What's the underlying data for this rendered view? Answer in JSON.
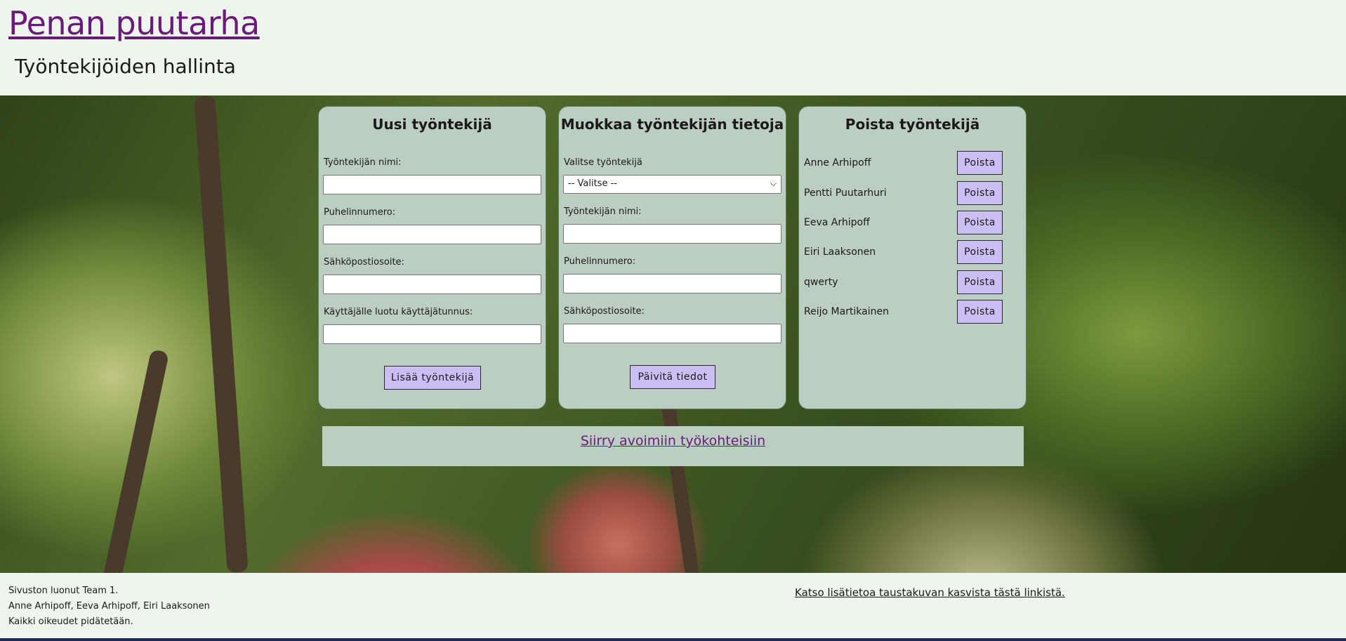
{
  "header": {
    "site_title": "Penan puutarha",
    "page_heading": "Työntekijöiden hallinta"
  },
  "add_panel": {
    "title": "Uusi työntekijä",
    "name_label": "Työntekijän nimi:",
    "phone_label": "Puhelinnumero:",
    "email_label": "Sähköpostiosoite:",
    "username_label": "Käyttäjälle luotu käyttäjätunnus:",
    "submit_label": "Lisää työntekijä"
  },
  "edit_panel": {
    "title": "Muokkaa työntekijän tietoja",
    "select_label": "Valitse työntekijä",
    "select_value": "-- Valitse --",
    "name_label": "Työntekijän nimi:",
    "phone_label": "Puhelinnumero:",
    "email_label": "Sähköpostiosoite:",
    "submit_label": "Päivitä tiedot"
  },
  "delete_panel": {
    "title": "Poista työntekijä",
    "button_label": "Poista",
    "employees": [
      "Anne Arhipoff",
      "Pentti Puutarhuri",
      "Eeva Arhipoff",
      "Eiri Laaksonen",
      "qwerty",
      "Reijo Martikainen"
    ]
  },
  "nav_link": "Siirry avoimiin työkohteisiin",
  "footer": {
    "line1": "Sivuston luonut Team 1.",
    "line2": "Anne Arhipoff, Eeva Arhipoff, Eiri Laaksonen",
    "line3": "Kaikki oikeudet pidätetään.",
    "info_link": "Katso lisätietoa taustakuvan kasvista tästä linkistä."
  },
  "colors": {
    "panel_bg": "#bccdc1",
    "button_bg": "#c9bff2",
    "link_color": "#6a1b7a",
    "page_bg": "#eef5ec"
  }
}
